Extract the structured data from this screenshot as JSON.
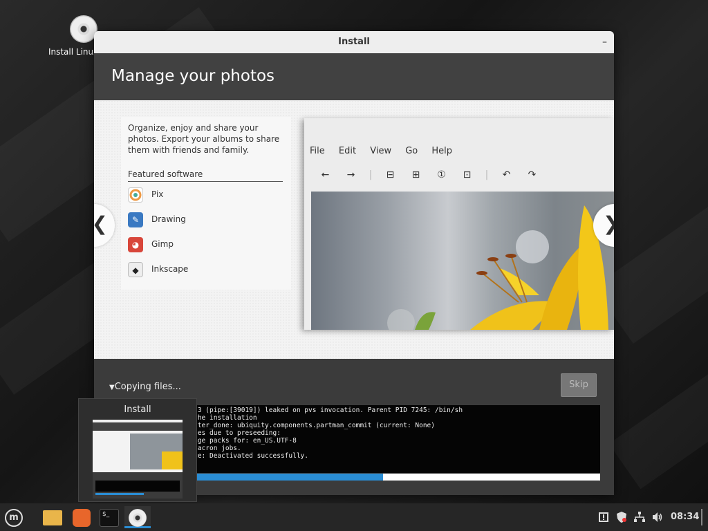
{
  "desktop": {
    "icon_label": "Install Linux Mint"
  },
  "window": {
    "title": "Install",
    "minimize_symbol": "–",
    "heading": "Manage your photos"
  },
  "slide": {
    "description": "Organize, enjoy and share your photos. Export your albums to share them with friends and family.",
    "featured_title": "Featured software",
    "apps": [
      {
        "name": "Pix",
        "icon": "pix-icon"
      },
      {
        "name": "Drawing",
        "icon": "drawing-icon"
      },
      {
        "name": "Gimp",
        "icon": "gimp-icon"
      },
      {
        "name": "Inkscape",
        "icon": "inkscape-icon"
      }
    ],
    "prev_symbol": "❮",
    "next_symbol": "❯",
    "screenshot_menu": [
      "File",
      "Edit",
      "View",
      "Go",
      "Help"
    ],
    "screenshot_tools": [
      "←",
      "→",
      "⊟",
      "⊞",
      "①",
      "⊡",
      "↶",
      "↷"
    ]
  },
  "progress": {
    "status": "Copying files...",
    "skip_label": "Skip",
    "fraction": 0.56,
    "log": [
      "uity: File descriptor 3 (pipe:[39019]) leaked on pvs invocation. Parent PID 7245: /bin/sh",
      "uity[2081]: Starting the installation",
      "uity[2081]: debconffilter_done: ubiquity.components.partman_commit (current: None)",
      "all.py: keeping packages due to preseeding:",
      "all.py: keeping language packs for: en_US.UTF-8",
      "end[1]: Started Run anacron jobs.",
      "end[1]: anacron.service: Deactivated successfully."
    ]
  },
  "preview": {
    "title": "Install"
  },
  "panel": {
    "clock": "08:34",
    "launchers": [
      "menu-icon",
      "files-icon",
      "firefox-icon",
      "terminal-icon",
      "installer-icon"
    ],
    "tray": [
      "notification-icon",
      "shield-icon",
      "network-icon",
      "volume-icon"
    ]
  },
  "colors": {
    "accent": "#2a8dd4",
    "panel": "#262626",
    "header": "#414141"
  }
}
